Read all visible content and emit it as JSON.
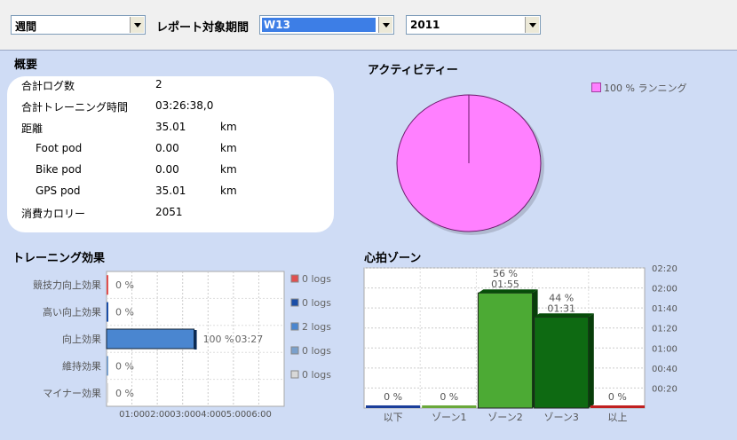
{
  "toolbar": {
    "period_type": "週間",
    "period_label": "レポート対象期間",
    "week": "W13",
    "year": "2011"
  },
  "summary": {
    "title": "概要",
    "rows": [
      {
        "label": "合計ログ数",
        "value": "2",
        "unit": ""
      },
      {
        "label": "合計トレーニング時間",
        "value": "03:26:38,0",
        "unit": ""
      },
      {
        "label": "距離",
        "value": "35.01",
        "unit": "km"
      },
      {
        "label": "Foot pod",
        "value": "0.00",
        "unit": "km"
      },
      {
        "label": "Bike pod",
        "value": "0.00",
        "unit": "km"
      },
      {
        "label": "GPS pod",
        "value": "35.01",
        "unit": "km"
      },
      {
        "label": "消費カロリー",
        "value": "2051",
        "unit": ""
      }
    ]
  },
  "activity": {
    "title": "アクティビティー",
    "legend": "100 % ランニング",
    "color": "#ff80ff"
  },
  "training_effect": {
    "title": "トレーニング効果",
    "x_ticks": [
      "01:00",
      "02:00",
      "03:00",
      "04:00",
      "05:00",
      "06:00"
    ],
    "colors": [
      "#e05050",
      "#1a4ea8",
      "#4a86d0",
      "#7aa0cc",
      "#d8d8d8"
    ]
  },
  "hr_zone": {
    "title": "心拍ゾーン",
    "y_ticks": [
      "02:20",
      "02:00",
      "01:40",
      "01:20",
      "01:00",
      "00:40",
      "00:20"
    ],
    "colors": [
      "#1a3e9a",
      "#6aa83a",
      "#4caa34",
      "#0e6a12",
      "#c02020"
    ]
  },
  "chart_data": [
    {
      "type": "bar",
      "orientation": "horizontal",
      "title": "トレーニング効果",
      "categories": [
        "競技力向上効果",
        "高い向上効果",
        "向上効果",
        "維持効果",
        "マイナー効果"
      ],
      "values_minutes": [
        0,
        0,
        207,
        0,
        0
      ],
      "percent_labels": [
        "0 %",
        "0 %",
        "100 %",
        "0 %",
        "0 %"
      ],
      "time_labels": [
        "",
        "",
        "03:27",
        "",
        ""
      ],
      "legend": [
        "0 logs",
        "0 logs",
        "2 logs",
        "0 logs",
        "0 logs"
      ],
      "xlim_minutes": [
        0,
        420
      ]
    },
    {
      "type": "bar",
      "title": "心拍ゾーン",
      "categories": [
        "以下",
        "ゾーン1",
        "ゾーン2",
        "ゾーン3",
        "以上"
      ],
      "values_minutes": [
        0,
        0,
        115,
        91,
        0
      ],
      "percent_labels": [
        "0 %",
        "0 %",
        "56 %",
        "44 %",
        "0 %"
      ],
      "time_labels": [
        "",
        "",
        "01:55",
        "01:31",
        ""
      ],
      "ylim_minutes": [
        0,
        140
      ]
    },
    {
      "type": "pie",
      "title": "アクティビティー",
      "labels": [
        "ランニング"
      ],
      "values": [
        100
      ]
    }
  ]
}
